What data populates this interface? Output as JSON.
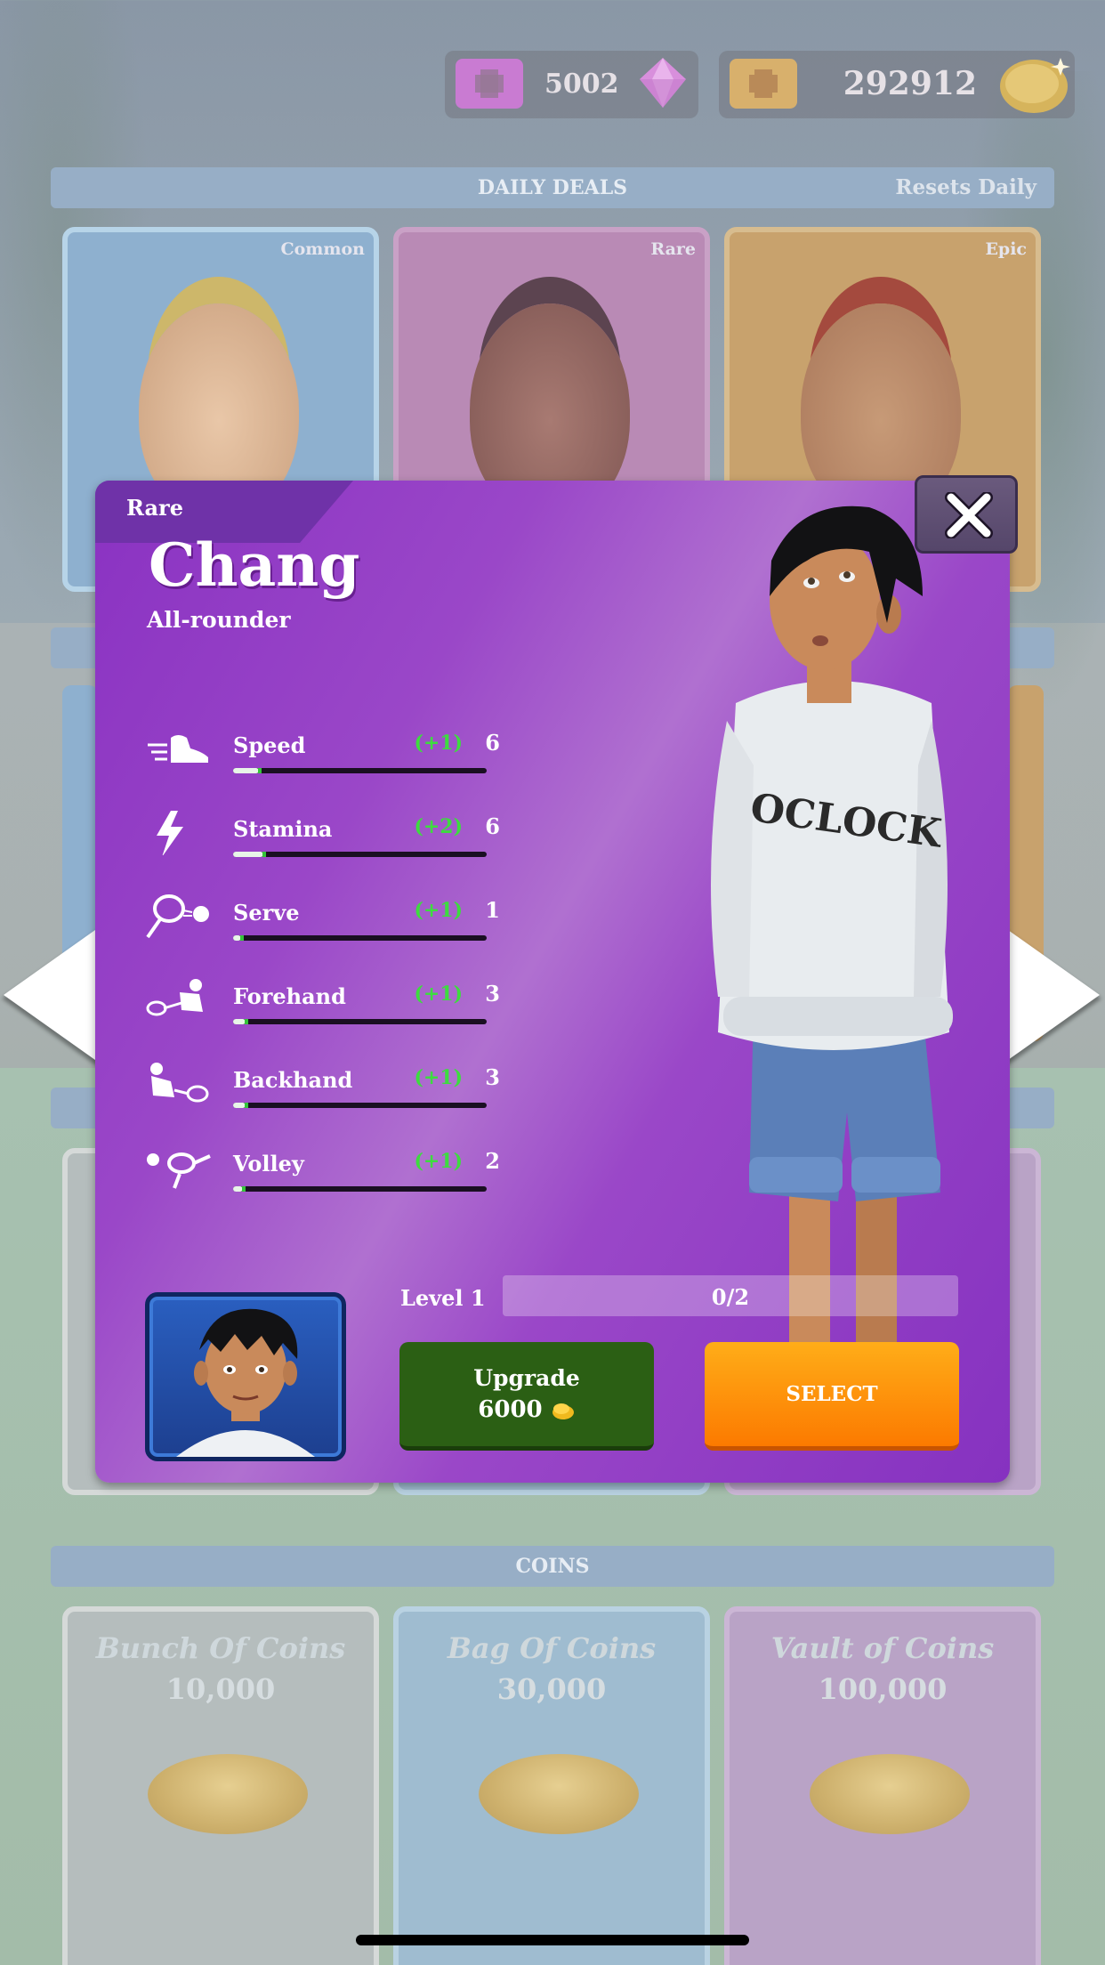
{
  "currency": {
    "gems": "5002",
    "coins": "292912"
  },
  "daily_deals": {
    "title": "DAILY DEALS",
    "resets": "Resets Daily",
    "cards": [
      {
        "rarity": "Common"
      },
      {
        "rarity": "Rare"
      },
      {
        "rarity": "Epic"
      }
    ]
  },
  "coins_section": {
    "title": "COINS",
    "packs": [
      {
        "name": "Bunch Of Coins",
        "amount": "10,000"
      },
      {
        "name": "Bag Of Coins",
        "amount": "30,000"
      },
      {
        "name": "Vault of Coins",
        "amount": "100,000"
      }
    ]
  },
  "modal": {
    "rarity": "Rare",
    "name": "Chang",
    "role": "All-rounder",
    "stats": [
      {
        "label": "Speed",
        "bonus": "(+1)",
        "value": "6",
        "icon": "shoe-icon",
        "fill": 0.1
      },
      {
        "label": "Stamina",
        "bonus": "(+2)",
        "value": "6",
        "icon": "lightning-icon",
        "fill": 0.12
      },
      {
        "label": "Serve",
        "bonus": "(+1)",
        "value": "1",
        "icon": "racket-ball-icon",
        "fill": 0.03
      },
      {
        "label": "Forehand",
        "bonus": "(+1)",
        "value": "3",
        "icon": "forehand-icon",
        "fill": 0.05
      },
      {
        "label": "Backhand",
        "bonus": "(+1)",
        "value": "3",
        "icon": "backhand-icon",
        "fill": 0.05
      },
      {
        "label": "Volley",
        "bonus": "(+1)",
        "value": "2",
        "icon": "volley-icon",
        "fill": 0.04
      }
    ],
    "level_label": "Level 1",
    "progress_text": "0/2",
    "progress": 0,
    "upgrade_label": "Upgrade",
    "upgrade_cost": "6000",
    "select_label": "SELECT",
    "hoodie_text": "OCLOCK"
  },
  "colors": {
    "modal_purple": "#8a32c2",
    "select_orange": "#fc7a00",
    "upgrade_green": "#2b5f14",
    "bonus_green": "#3ddc3f",
    "portrait_blue": "#2a5fc0"
  }
}
